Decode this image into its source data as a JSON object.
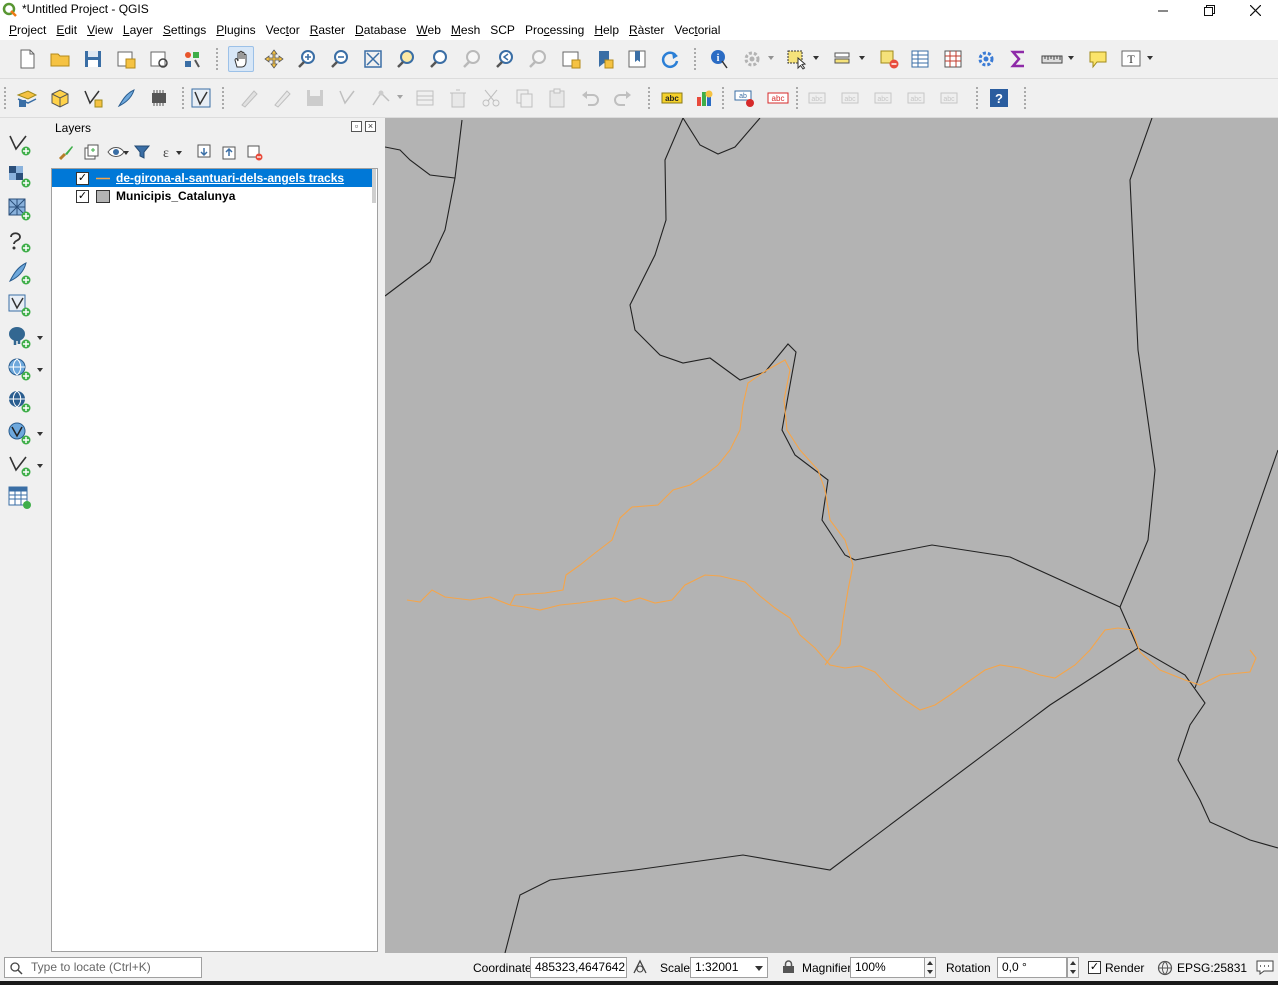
{
  "window": {
    "title": "*Untitled Project - QGIS",
    "controls": [
      "minimize-icon",
      "restore-icon",
      "close-icon"
    ]
  },
  "menu": [
    "Project",
    "Edit",
    "View",
    "Layer",
    "Settings",
    "Plugins",
    "Vector",
    "Raster",
    "Database",
    "Web",
    "Mesh",
    "SCP",
    "Processing",
    "Help",
    "Ràster",
    "Vectorial"
  ],
  "menu_underline_index": [
    0,
    0,
    0,
    0,
    0,
    0,
    3,
    0,
    0,
    0,
    0,
    -1,
    3,
    0,
    0,
    3
  ],
  "layers_panel": {
    "title": "Layers",
    "layers": [
      {
        "name": "de-girona-al-santuari-dels-angels tracks",
        "checked": "✓",
        "selected": true,
        "symbol": "line-symbol"
      },
      {
        "name": "Municipis_Catalunya",
        "checked": "✓",
        "selected": false,
        "symbol": "polygon-symbol"
      }
    ]
  },
  "colors": {
    "map_background": "#b3b3b3",
    "boundary_line": "#222222",
    "track_line": "#f5a54a",
    "selection": "#0078d7"
  },
  "statusbar": {
    "locator_placeholder": "Type to locate (Ctrl+K)",
    "coordinate_label": "Coordinate",
    "coordinate_value": "485323,4647642",
    "scale_label": "Scale",
    "scale_value": "1:32001",
    "magnifier_label": "Magnifier",
    "magnifier_value": "100%",
    "rotation_label": "Rotation",
    "rotation_value": "0,0 °",
    "render_label": "Render",
    "render_checked": "✓",
    "crs": "EPSG:25831"
  }
}
